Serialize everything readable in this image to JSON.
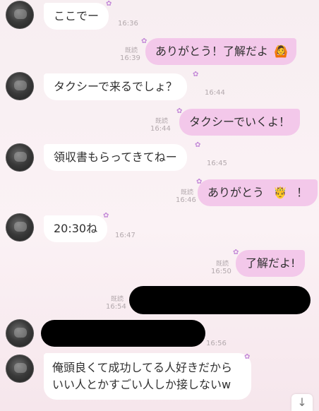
{
  "messages": [
    {
      "text": "ここでー",
      "time": "16:36"
    },
    {
      "text": "ありがとう！了解だよ",
      "read": "既読",
      "time": "16:39"
    },
    {
      "text": "タクシーで来るでしょ？",
      "time": "16:44"
    },
    {
      "text": "タクシーでいくよ！",
      "read": "既読",
      "time": "16:44"
    },
    {
      "text": "領収書もらってきてねー",
      "time": "16:45"
    },
    {
      "text": "ありがとう",
      "text_end": "！",
      "read": "既読",
      "time": "16:46"
    },
    {
      "text": "20:30ね",
      "time": "16:47"
    },
    {
      "text": "了解だよ!",
      "read": "既読",
      "time": "16:50"
    },
    {
      "read": "既読",
      "time": "16:54"
    },
    {
      "time": "16:56"
    },
    {
      "text": "俺頭良くて成功してる人好きだからいい人とかすごい人しか接しないw"
    }
  ],
  "emoji": {
    "person_gesturing_ok": "🙆",
    "crown_face": "🤴"
  },
  "scroll_button": {
    "icon": "arrow-down-icon",
    "glyph": "↓"
  },
  "colors": {
    "sent_bubble": "#f3c8ea",
    "received_bubble": "#ffffff",
    "redaction": "#000000"
  }
}
